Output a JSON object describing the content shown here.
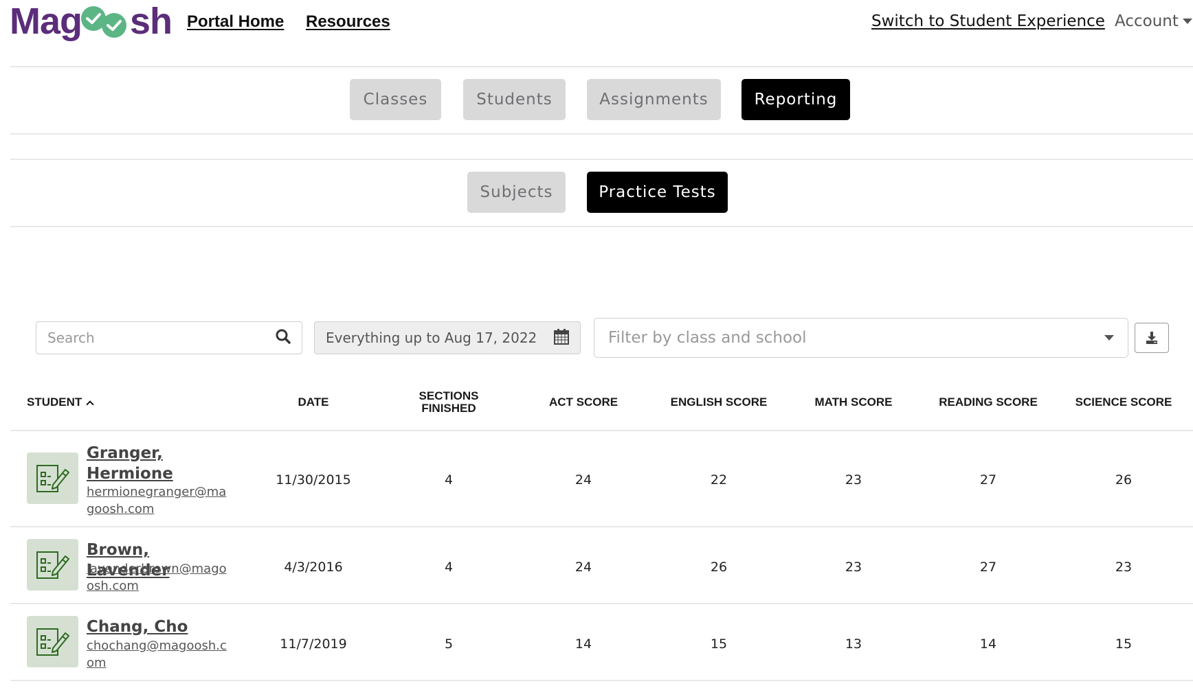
{
  "brand": {
    "name": "Magoosh",
    "text_left": "Mag",
    "text_right": "sh",
    "purple": "#5b2d7a",
    "green": "#5cb585"
  },
  "nav": {
    "links": [
      {
        "label": "Portal Home"
      },
      {
        "label": "Resources"
      }
    ],
    "switch_label": "Switch to Student Experience",
    "account_label": "Account"
  },
  "main_tabs": [
    {
      "label": "Classes",
      "active": false
    },
    {
      "label": "Students",
      "active": false
    },
    {
      "label": "Assignments",
      "active": false
    },
    {
      "label": "Reporting",
      "active": true
    }
  ],
  "sub_tabs": [
    {
      "label": "Subjects",
      "active": false
    },
    {
      "label": "Practice Tests",
      "active": true
    }
  ],
  "filters": {
    "search_placeholder": "Search",
    "search_icon": "search-icon",
    "date_range": "Everything up to Aug 17, 2022",
    "date_icon": "calendar-icon",
    "class_filter_placeholder": "Filter by class and school",
    "download_icon": "download-icon"
  },
  "table": {
    "columns": [
      {
        "label": "STUDENT",
        "sort": "ascending"
      },
      {
        "label": "DATE"
      },
      {
        "label": "SECTIONS FINISHED",
        "line1": "SECTIONS",
        "line2": "FINISHED"
      },
      {
        "label": "ACT SCORE"
      },
      {
        "label": "ENGLISH SCORE"
      },
      {
        "label": "MATH SCORE"
      },
      {
        "label": "READING SCORE"
      },
      {
        "label": "SCIENCE SCORE"
      }
    ],
    "rows": [
      {
        "name": "Granger, Hermione",
        "email": "hermionegranger@magoosh.com",
        "date": "11/30/2015",
        "sections": "4",
        "act": "24",
        "english": "22",
        "math": "23",
        "reading": "27",
        "science": "26"
      },
      {
        "name": "Brown, Lavender",
        "email": "lavenderbrown@magoosh.com",
        "date": "4/3/2016",
        "sections": "4",
        "act": "24",
        "english": "26",
        "math": "23",
        "reading": "27",
        "science": "23"
      },
      {
        "name": "Chang, Cho",
        "email": "chochang@magoosh.com",
        "date": "11/7/2019",
        "sections": "5",
        "act": "14",
        "english": "15",
        "math": "13",
        "reading": "14",
        "science": "15"
      }
    ]
  }
}
